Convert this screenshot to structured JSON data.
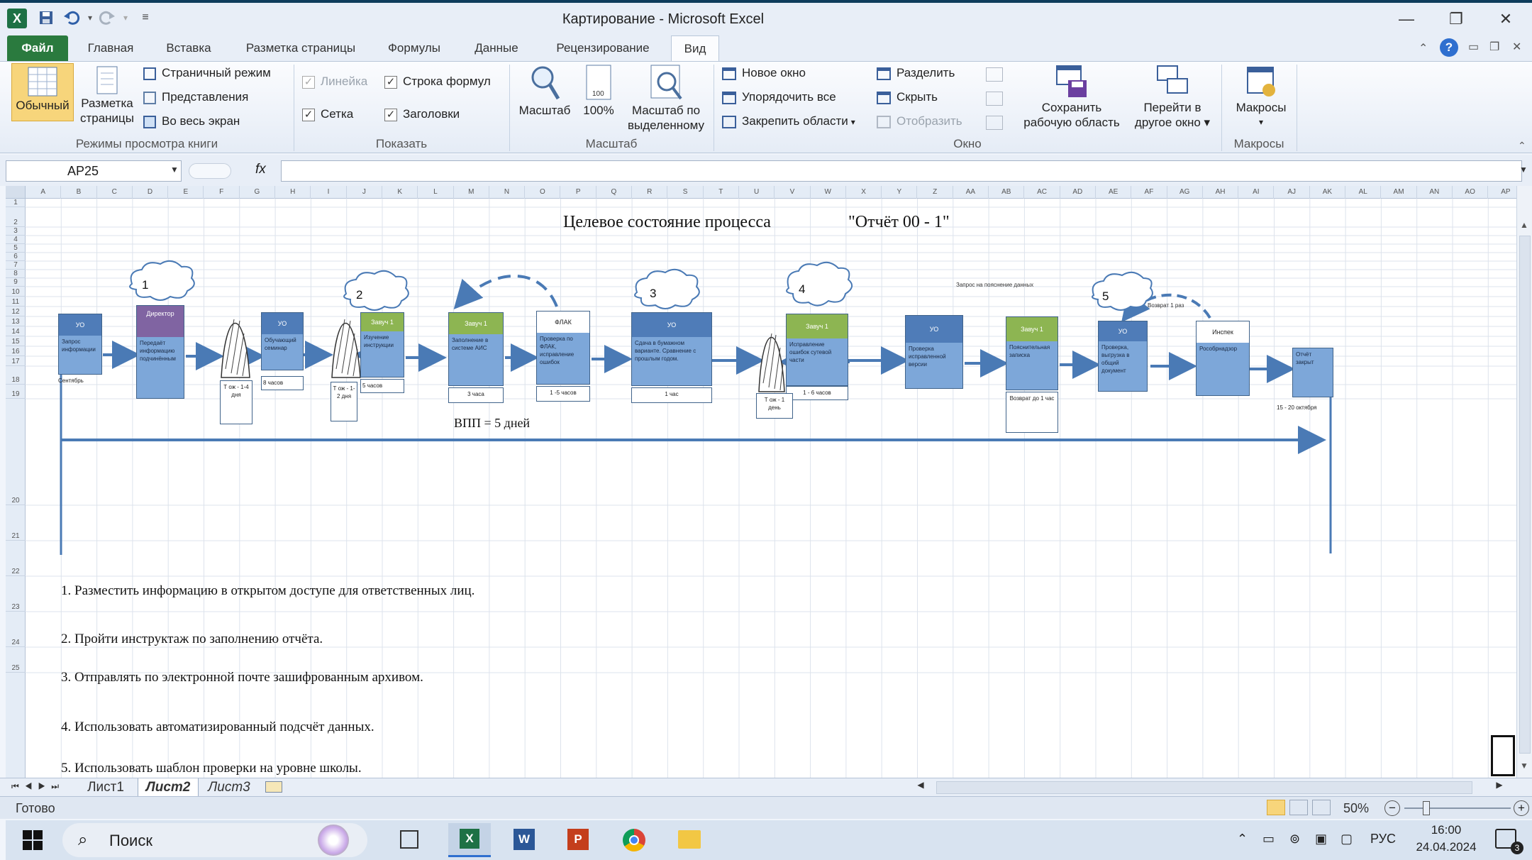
{
  "window": {
    "title": "Картирование  -  Microsoft Excel",
    "logo": "X",
    "controls": [
      "—",
      "❐",
      "✕"
    ]
  },
  "tabs": [
    "Файл",
    "Главная",
    "Вставка",
    "Разметка страницы",
    "Формулы",
    "Данные",
    "Рецензирование",
    "Вид"
  ],
  "ribbon": {
    "views": {
      "normal": "Обычный",
      "page_layout_1": "Разметка",
      "page_layout_2": "страницы",
      "page_break": "Страничный режим",
      "custom_views": "Представления",
      "full_screen": "Во весь экран",
      "group": "Режимы просмотра книги"
    },
    "show": {
      "ruler": "Линейка",
      "formula_bar": "Строка формул",
      "gridlines": "Сетка",
      "headings": "Заголовки",
      "group": "Показать"
    },
    "zoom": {
      "zoom": "Масштаб",
      "hundred": "100%",
      "selection_1": "Масштаб по",
      "selection_2": "выделенному",
      "group": "Масштаб"
    },
    "window": {
      "new": "Новое окно",
      "arrange": "Упорядочить все",
      "freeze": "Закрепить области",
      "split": "Разделить",
      "hide": "Скрыть",
      "unhide": "Отобразить",
      "save_ws_1": "Сохранить",
      "save_ws_2": "рабочую область",
      "switch_1": "Перейти в",
      "switch_2": "другое окно",
      "group": "Окно"
    },
    "macros": {
      "macros": "Макросы",
      "group": "Макросы"
    }
  },
  "formula": {
    "namebox": "AP25",
    "fx": "fx",
    "value": ""
  },
  "columns": [
    "A",
    "B",
    "C",
    "D",
    "E",
    "F",
    "G",
    "H",
    "I",
    "J",
    "K",
    "L",
    "M",
    "N",
    "O",
    "P",
    "Q",
    "R",
    "S",
    "T",
    "U",
    "V",
    "W",
    "X",
    "Y",
    "Z",
    "AA",
    "AB",
    "AC",
    "AD",
    "AE",
    "AF",
    "AG",
    "AH",
    "AI",
    "AJ",
    "AK",
    "AL",
    "AM",
    "AN",
    "AO",
    "AP"
  ],
  "rows": [
    "1",
    "2",
    "3",
    "4",
    "5",
    "6",
    "7",
    "8",
    "9",
    "10",
    "11",
    "12",
    "13",
    "14",
    "15",
    "16",
    "17",
    "18",
    "19",
    "20",
    "21",
    "22",
    "23",
    "24",
    "25"
  ],
  "sheet": {
    "title": "Целевое состояние процесса",
    "report": "\"Отчёт 00 - 1\"",
    "vpp": "ВПП = 5 дней",
    "query_note": "Запрос на пояснение данных",
    "return_note": "Возврат  1 раз",
    "clouds": [
      "1",
      "2",
      "3",
      "4",
      "5"
    ],
    "boxes": [
      {
        "head": "УО",
        "body": "Запрос информации",
        "foot": "Сентябрь"
      },
      {
        "head": "Директор",
        "body": "Передаёт информацию подчинённым",
        "foot": ""
      },
      {
        "head": "УО",
        "body": "Обучающий семинар",
        "foot": "8 часов"
      },
      {
        "head": "Завуч 1",
        "body": "Изучение инструкции",
        "foot": "5 часов"
      },
      {
        "head": "Завуч 1",
        "body": "Заполнение в системе АИС",
        "foot": "3 часа"
      },
      {
        "head": "ФЛАК",
        "body": "Проверка по ФЛАК, исправление ошибок",
        "foot": "1 -5 часов"
      },
      {
        "head": "УО",
        "body": "Сдача в бумажном варианте. Сравнение с прошлым годом.",
        "foot": "1 час"
      },
      {
        "head": "Завуч 1",
        "body": "Исправление ошибок сутевой части",
        "foot": "1 - 6 часов"
      },
      {
        "head": "УО",
        "body": "Проверка исправленной версии",
        "foot": ""
      },
      {
        "head": "Завуч 1",
        "body": "Пояснительная записка",
        "foot": "Возврат до 1 час"
      },
      {
        "head": "УО",
        "body": "Проверка, выгрузка в общий документ",
        "foot": ""
      },
      {
        "head": "Инспек",
        "body": "Рособрнадзор",
        "foot": ""
      },
      {
        "head": "",
        "body": "Отчёт закрыт",
        "foot": "15 - 20 октября"
      }
    ],
    "waits": [
      "Т ож - 1-4 дня",
      "Т ож - 1-2 дня",
      "Т ож - 1 день"
    ],
    "notes": [
      "1. Разместить информацию в открытом доступе для ответственных лиц.",
      "2. Пройти инструктаж по заполнению отчёта.",
      "3. Отправлять  по электронной почте  зашифрованным архивом.",
      "4. Использовать автоматизированный подсчёт данных.",
      "5. Использовать шаблон проверки на уровне школы."
    ]
  },
  "sheet_tabs": [
    "Лист1",
    "Лист2",
    "Лист3"
  ],
  "status": {
    "ready": "Готово",
    "zoom": "50%"
  },
  "taskbar": {
    "search": "Поиск",
    "lang": "РУС",
    "time": "16:00",
    "date": "24.04.2024",
    "notif": "3"
  },
  "colors": {
    "box_blue": "#7da7d9",
    "box_head_blue": "#4f7cb8",
    "box_head_green": "#8db552",
    "box_head_purple": "#8064a2",
    "arrow": "#4a7ab5",
    "file_tab": "#2a7a3e"
  }
}
